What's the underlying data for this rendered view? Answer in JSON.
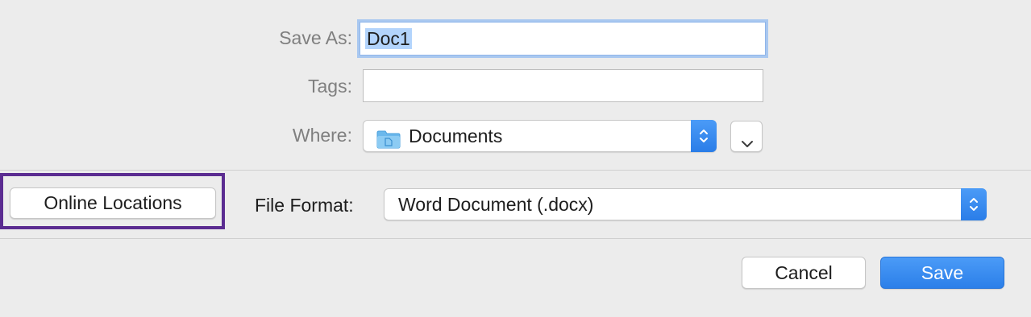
{
  "dialog": {
    "save_as": {
      "label": "Save As:",
      "value": "Doc1"
    },
    "tags": {
      "label": "Tags:",
      "value": ""
    },
    "where": {
      "label": "Where:",
      "selected": "Documents",
      "folder_icon": "folder-icon",
      "expand_icon": "chevron-down-icon"
    },
    "online_locations_label": "Online Locations",
    "file_format": {
      "label": "File Format:",
      "selected": "Word Document (.docx)"
    },
    "cancel_label": "Cancel",
    "save_label": "Save",
    "colors": {
      "accent": "#2b7fe9",
      "highlight_border": "#5b2c91",
      "background": "#ececec"
    }
  }
}
